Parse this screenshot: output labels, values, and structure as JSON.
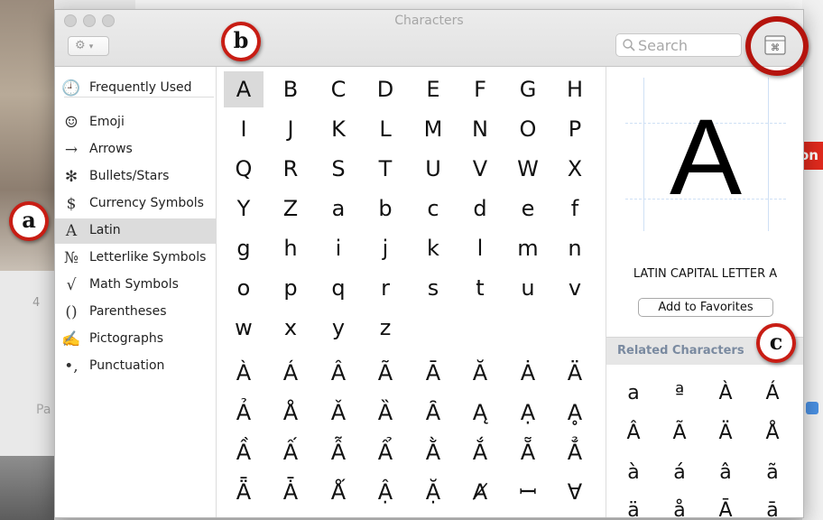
{
  "window": {
    "title": "Characters"
  },
  "search": {
    "placeholder": "Search"
  },
  "sidebar": {
    "items": [
      {
        "icon": "🕘",
        "icon_name": "clock-icon",
        "label": "Frequently Used"
      },
      {
        "icon": "☺",
        "icon_name": "smiley-icon",
        "label": "Emoji"
      },
      {
        "icon": "→",
        "icon_name": "arrow-icon",
        "label": "Arrows"
      },
      {
        "icon": "✻",
        "icon_name": "asterisk-icon",
        "label": "Bullets/Stars"
      },
      {
        "icon": "$",
        "icon_name": "dollar-icon",
        "label": "Currency Symbols"
      },
      {
        "icon": "A",
        "icon_name": "latin-a-icon",
        "label": "Latin",
        "selected": true
      },
      {
        "icon": "№",
        "icon_name": "numero-icon",
        "label": "Letterlike Symbols"
      },
      {
        "icon": "√",
        "icon_name": "square-root-icon",
        "label": "Math Symbols"
      },
      {
        "icon": "()",
        "icon_name": "parentheses-icon",
        "label": "Parentheses"
      },
      {
        "icon": "✍",
        "icon_name": "writing-hand-icon",
        "label": "Pictographs"
      },
      {
        "icon": "•,",
        "icon_name": "punctuation-icon",
        "label": "Punctuation"
      }
    ]
  },
  "grid": {
    "selected": "A",
    "rows": [
      [
        "A",
        "B",
        "C",
        "D",
        "E",
        "F",
        "G",
        "H"
      ],
      [
        "I",
        "J",
        "K",
        "L",
        "M",
        "N",
        "O",
        "P"
      ],
      [
        "Q",
        "R",
        "S",
        "T",
        "U",
        "V",
        "W",
        "X"
      ],
      [
        "Y",
        "Z",
        "a",
        "b",
        "c",
        "d",
        "e",
        "f"
      ],
      [
        "g",
        "h",
        "i",
        "j",
        "k",
        "l",
        "m",
        "n"
      ],
      [
        "o",
        "p",
        "q",
        "r",
        "s",
        "t",
        "u",
        "v"
      ],
      [
        "w",
        "x",
        "y",
        "z"
      ],
      [
        "À",
        "Á",
        "Â",
        "Ã",
        "Ā",
        "Ă",
        "Ȧ",
        "Ä"
      ],
      [
        "Ả",
        "Å",
        "Ǎ",
        "Ȁ",
        "Ȃ",
        "Ą",
        "Ạ",
        "Ḁ"
      ],
      [
        "Ầ",
        "Ấ",
        "Ẫ",
        "Ẩ",
        "Ằ",
        "Ắ",
        "Ẵ",
        "Ẳ"
      ],
      [
        "Ǟ",
        "Ǡ",
        "Ǻ",
        "Ậ",
        "Ặ",
        "Ⱥ",
        "ꟷ",
        "Ɐ"
      ]
    ]
  },
  "preview": {
    "char": "A",
    "name": "LATIN CAPITAL LETTER A",
    "favorites_label": "Add to Favorites"
  },
  "related": {
    "label": "Related Characters",
    "rows": [
      [
        "a",
        "ª",
        "À",
        "Á"
      ],
      [
        "Â",
        "Ã",
        "Ä",
        "Å"
      ],
      [
        "à",
        "á",
        "â",
        "ã"
      ],
      [
        "ä",
        "å",
        "Ā",
        "ā"
      ]
    ]
  },
  "callouts": [
    "a",
    "b",
    "c"
  ],
  "background": {
    "red_tab_text": "on",
    "left_number": "4",
    "left_tab_text": "Pa"
  },
  "colors": {
    "callout_red": "#c81d14",
    "selection_gray": "#dadada",
    "related_header_text": "#7a8aa0"
  }
}
